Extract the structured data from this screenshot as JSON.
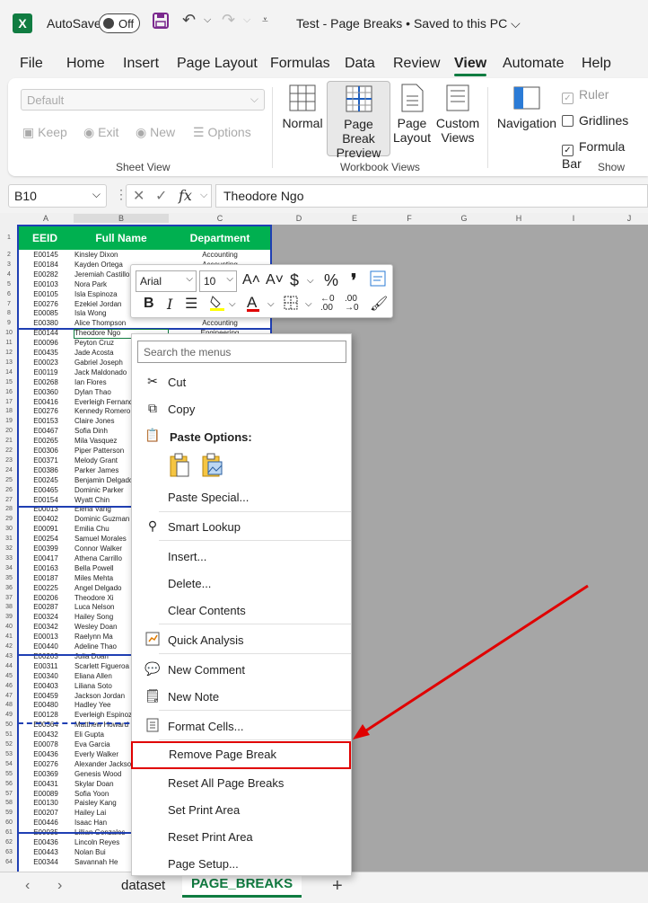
{
  "titlebar": {
    "autosave_label": "AutoSave",
    "toggle_state": "Off",
    "document_title": "Test - Page Breaks • Saved to this PC ⌵"
  },
  "menu_tabs": [
    "File",
    "Home",
    "Insert",
    "Page Layout",
    "Formulas",
    "Data",
    "Review",
    "View",
    "Automate",
    "Help"
  ],
  "active_tab": "View",
  "ribbon": {
    "sheet_view": {
      "dropdown_value": "Default",
      "keep": "Keep",
      "exit": "Exit",
      "new": "New",
      "options": "Options",
      "label": "Sheet View"
    },
    "workbook_views": {
      "normal": "Normal",
      "page_break_preview_1": "Page Break",
      "page_break_preview_2": "Preview",
      "page_layout_1": "Page",
      "page_layout_2": "Layout",
      "custom_views_1": "Custom",
      "custom_views_2": "Views",
      "label": "Workbook Views"
    },
    "show": {
      "navigation": "Navigation",
      "ruler": "Ruler",
      "gridlines": "Gridlines",
      "formula_bar": "Formula Bar",
      "label": "Show"
    }
  },
  "formula_bar": {
    "name_box": "B10",
    "content": "Theodore Ngo"
  },
  "columns": [
    "A",
    "B",
    "C",
    "D",
    "E",
    "F",
    "G",
    "H",
    "I",
    "J"
  ],
  "table_headers": [
    "EEID",
    "Full Name",
    "Department"
  ],
  "rows": [
    {
      "n": "2",
      "id": "E00145",
      "name": "Kinsley Dixon",
      "dept": "Accounting"
    },
    {
      "n": "3",
      "id": "E00184",
      "name": "Kayden Ortega",
      "dept": "Accounting"
    },
    {
      "n": "4",
      "id": "E00282",
      "name": "Jeremiah Castillo",
      "dept": ""
    },
    {
      "n": "5",
      "id": "E00103",
      "name": "Nora Park",
      "dept": ""
    },
    {
      "n": "6",
      "id": "E00105",
      "name": "Isla Espinoza",
      "dept": ""
    },
    {
      "n": "7",
      "id": "E00276",
      "name": "Ezekiel Jordan",
      "dept": ""
    },
    {
      "n": "8",
      "id": "E00085",
      "name": "Isla Wong",
      "dept": ""
    },
    {
      "n": "9",
      "id": "E00380",
      "name": "Alice Thompson",
      "dept": "Accounting"
    },
    {
      "n": "10",
      "id": "E00144",
      "name": "Theodore Ngo",
      "dept": "Engineering"
    },
    {
      "n": "11",
      "id": "E00096",
      "name": "Peyton Cruz",
      "dept": ""
    },
    {
      "n": "12",
      "id": "E00435",
      "name": "Jade Acosta",
      "dept": ""
    },
    {
      "n": "13",
      "id": "E00023",
      "name": "Gabriel Joseph",
      "dept": ""
    },
    {
      "n": "14",
      "id": "E00119",
      "name": "Jack Maldonado",
      "dept": ""
    },
    {
      "n": "15",
      "id": "E00268",
      "name": "Ian Flores",
      "dept": ""
    },
    {
      "n": "16",
      "id": "E00360",
      "name": "Dylan Thao",
      "dept": ""
    },
    {
      "n": "17",
      "id": "E00416",
      "name": "Everleigh Fernandez",
      "dept": ""
    },
    {
      "n": "18",
      "id": "E00276",
      "name": "Kennedy Romero",
      "dept": ""
    },
    {
      "n": "19",
      "id": "E00153",
      "name": "Claire Jones",
      "dept": ""
    },
    {
      "n": "20",
      "id": "E00467",
      "name": "Sofia Dinh",
      "dept": ""
    },
    {
      "n": "21",
      "id": "E00265",
      "name": "Mila Vasquez",
      "dept": ""
    },
    {
      "n": "22",
      "id": "E00306",
      "name": "Piper Patterson",
      "dept": ""
    },
    {
      "n": "23",
      "id": "E00371",
      "name": "Melody Grant",
      "dept": ""
    },
    {
      "n": "24",
      "id": "E00386",
      "name": "Parker James",
      "dept": ""
    },
    {
      "n": "25",
      "id": "E00245",
      "name": "Benjamin Delgado",
      "dept": ""
    },
    {
      "n": "26",
      "id": "E00465",
      "name": "Dominic Parker",
      "dept": ""
    },
    {
      "n": "27",
      "id": "E00154",
      "name": "Wyatt Chin",
      "dept": ""
    },
    {
      "n": "28",
      "id": "E00013",
      "name": "Elena Vang",
      "dept": ""
    },
    {
      "n": "29",
      "id": "E00402",
      "name": "Dominic Guzman",
      "dept": ""
    },
    {
      "n": "30",
      "id": "E00091",
      "name": "Emilia Chu",
      "dept": ""
    },
    {
      "n": "31",
      "id": "E00254",
      "name": "Samuel Morales",
      "dept": ""
    },
    {
      "n": "32",
      "id": "E00399",
      "name": "Connor Walker",
      "dept": ""
    },
    {
      "n": "33",
      "id": "E00417",
      "name": "Athena Carrillo",
      "dept": ""
    },
    {
      "n": "34",
      "id": "E00163",
      "name": "Bella Powell",
      "dept": ""
    },
    {
      "n": "35",
      "id": "E00187",
      "name": "Miles Mehta",
      "dept": ""
    },
    {
      "n": "36",
      "id": "E00225",
      "name": "Angel Delgado",
      "dept": ""
    },
    {
      "n": "37",
      "id": "E00206",
      "name": "Theodore Xi",
      "dept": ""
    },
    {
      "n": "38",
      "id": "E00287",
      "name": "Luca Nelson",
      "dept": ""
    },
    {
      "n": "39",
      "id": "E00324",
      "name": "Hailey Song",
      "dept": ""
    },
    {
      "n": "40",
      "id": "E00342",
      "name": "Wesley Doan",
      "dept": ""
    },
    {
      "n": "41",
      "id": "E00013",
      "name": "Raelynn Ma",
      "dept": ""
    },
    {
      "n": "42",
      "id": "E00440",
      "name": "Adeline Thao",
      "dept": ""
    },
    {
      "n": "43",
      "id": "E00203",
      "name": "Julia Doan",
      "dept": ""
    },
    {
      "n": "44",
      "id": "E00311",
      "name": "Scarlett Figueroa",
      "dept": ""
    },
    {
      "n": "45",
      "id": "E00340",
      "name": "Eliana Allen",
      "dept": ""
    },
    {
      "n": "46",
      "id": "E00403",
      "name": "Liliana Soto",
      "dept": ""
    },
    {
      "n": "47",
      "id": "E00459",
      "name": "Jackson Jordan",
      "dept": ""
    },
    {
      "n": "48",
      "id": "E00480",
      "name": "Hadley Yee",
      "dept": ""
    },
    {
      "n": "49",
      "id": "E00128",
      "name": "Everleigh Espinoza",
      "dept": ""
    },
    {
      "n": "50",
      "id": "E00364",
      "name": "Matthew Howard",
      "dept": ""
    },
    {
      "n": "51",
      "id": "E00432",
      "name": "Eli Gupta",
      "dept": ""
    },
    {
      "n": "52",
      "id": "E00078",
      "name": "Eva Garcia",
      "dept": ""
    },
    {
      "n": "53",
      "id": "E00436",
      "name": "Everly Walker",
      "dept": ""
    },
    {
      "n": "54",
      "id": "E00276",
      "name": "Alexander Jackson",
      "dept": ""
    },
    {
      "n": "55",
      "id": "E00369",
      "name": "Genesis Wood",
      "dept": ""
    },
    {
      "n": "56",
      "id": "E00431",
      "name": "Skylar Doan",
      "dept": ""
    },
    {
      "n": "57",
      "id": "E00089",
      "name": "Sofia Yoon",
      "dept": ""
    },
    {
      "n": "58",
      "id": "E00130",
      "name": "Paisley Kang",
      "dept": ""
    },
    {
      "n": "59",
      "id": "E00207",
      "name": "Hailey Lai",
      "dept": ""
    },
    {
      "n": "60",
      "id": "E00446",
      "name": "Isaac Han",
      "dept": ""
    },
    {
      "n": "61",
      "id": "E00035",
      "name": "Lillian Gonzales",
      "dept": ""
    },
    {
      "n": "62",
      "id": "E00436",
      "name": "Lincoln Reyes",
      "dept": ""
    },
    {
      "n": "63",
      "id": "E00443",
      "name": "Nolan Bui",
      "dept": ""
    },
    {
      "n": "64",
      "id": "E00344",
      "name": "Savannah He",
      "dept": ""
    }
  ],
  "mini_toolbar": {
    "font": "Arial",
    "size": "10"
  },
  "context_menu": {
    "search_placeholder": "Search the menus",
    "cut": "Cut",
    "copy": "Copy",
    "paste_options": "Paste Options:",
    "paste_special": "Paste Special...",
    "smart_lookup": "Smart Lookup",
    "insert": "Insert...",
    "delete": "Delete...",
    "clear_contents": "Clear Contents",
    "quick_analysis": "Quick Analysis",
    "new_comment": "New Comment",
    "new_note": "New Note",
    "format_cells": "Format Cells...",
    "remove_page_break": "Remove Page Break",
    "reset_all_page_breaks": "Reset All Page Breaks",
    "set_print_area": "Set Print Area",
    "reset_print_area": "Reset Print Area",
    "page_setup": "Page Setup..."
  },
  "sheet_tabs": {
    "dataset": "dataset",
    "page_breaks": "PAGE_BREAKS",
    "add": "+"
  },
  "colors": {
    "accent": "#107c41",
    "header_green": "#00b050",
    "page_break_blue": "#1f3fb3",
    "annotation_red": "#e00000"
  }
}
